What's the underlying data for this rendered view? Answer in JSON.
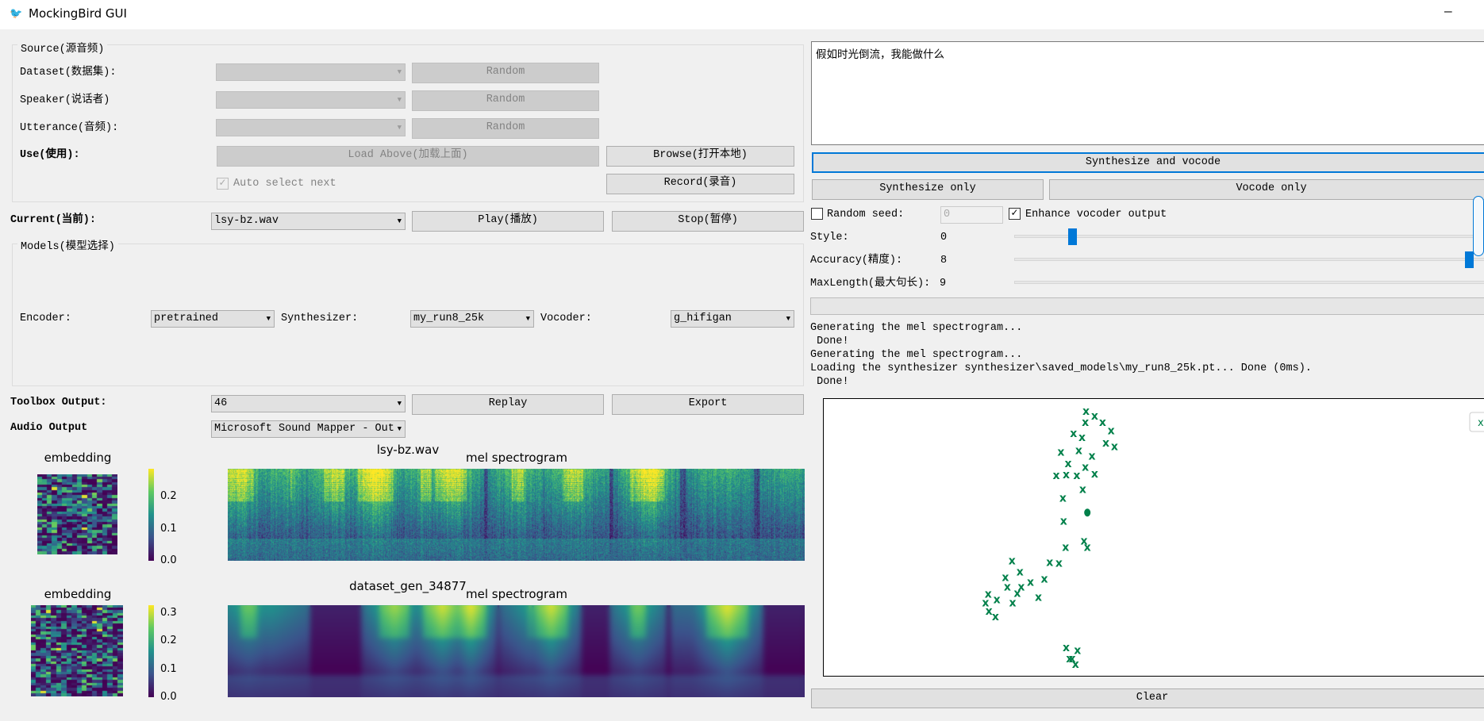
{
  "window": {
    "title": "MockingBird GUI",
    "minimize_icon": "minimize-icon"
  },
  "source": {
    "title": "Source(源音频)",
    "dataset_label": "Dataset(数据集):",
    "speaker_label": "Speaker(说话者)",
    "utterance_label": "Utterance(音频):",
    "random_label": "Random",
    "use_label": "Use(使用):",
    "load_above": "Load Above(加载上面)",
    "browse": "Browse(打开本地)",
    "record": "Record(录音)",
    "auto_select": "Auto select next",
    "auto_select_checked": true
  },
  "current": {
    "label": "Current(当前):",
    "value": "lsy-bz.wav",
    "play": "Play(播放)",
    "stop": "Stop(暂停)"
  },
  "models": {
    "title": "Models(模型选择)",
    "encoder_label": "Encoder:",
    "encoder": "pretrained",
    "synth_label": "Synthesizer:",
    "synth": "my_run8_25k",
    "vocoder_label": "Vocoder:",
    "vocoder": "g_hifigan"
  },
  "toolbox": {
    "label": "Toolbox Output:",
    "value": "46",
    "replay": "Replay",
    "export": "Export",
    "audio_label": "Audio Output",
    "audio_value": "Microsoft Sound Mapper - Out"
  },
  "plots": {
    "row1": {
      "embedding_title": "embedding",
      "file_title": "lsy-bz.wav",
      "mel_title": "mel spectrogram",
      "ticks": [
        "0.2",
        "0.1",
        "0.0"
      ]
    },
    "row2": {
      "embedding_title": "embedding",
      "file_title": "dataset_gen_34877",
      "mel_title": "mel spectrogram",
      "ticks": [
        "0.3",
        "0.2",
        "0.1",
        "0.0"
      ]
    }
  },
  "text_input": "假如时光倒流，我能做什么",
  "actions": {
    "synth_vocode": "Synthesize and vocode",
    "synth_only": "Synthesize only",
    "vocode_only": "Vocode only",
    "clear": "Clear"
  },
  "options": {
    "random_seed_label": "Random seed:",
    "random_seed_checked": false,
    "seed_value": "0",
    "enhance_label": "Enhance vocoder output",
    "enhance_checked": true,
    "style_label": "Style:",
    "style_value": "0",
    "accuracy_label": "Accuracy(精度):",
    "accuracy_value": "8",
    "maxlength_label": "MaxLength(最大句长):",
    "maxlength_value": "9"
  },
  "progress": 0,
  "log": [
    "Generating the mel spectrogram...",
    " Done!",
    "Generating the mel spectrogram...",
    "Loading the synthesizer synthesizer\\saved_models\\my_run8_25k.pt... Done (0ms).",
    " Done!"
  ],
  "accent_color": "#0078d7",
  "chart_data": {
    "type": "scatter",
    "xlim": [
      0,
      100
    ],
    "ylim": [
      0,
      100
    ],
    "grid": false,
    "color": "#00804a",
    "legend": "top-right",
    "points_x_marker": [
      [
        39.8,
        95.4
      ],
      [
        41.1,
        93.7
      ],
      [
        39.7,
        91.4
      ],
      [
        42.3,
        91.4
      ],
      [
        43.6,
        88.5
      ],
      [
        37.9,
        87.4
      ],
      [
        39.2,
        86.0
      ],
      [
        42.8,
        84.0
      ],
      [
        44.1,
        82.8
      ],
      [
        36.0,
        80.8
      ],
      [
        38.7,
        81.4
      ],
      [
        40.7,
        79.4
      ],
      [
        37.1,
        76.6
      ],
      [
        39.7,
        75.4
      ],
      [
        35.3,
        72.3
      ],
      [
        36.8,
        72.6
      ],
      [
        38.4,
        72.3
      ],
      [
        41.1,
        73.0
      ],
      [
        39.3,
        67.4
      ],
      [
        36.3,
        64.3
      ],
      [
        36.4,
        56.0
      ],
      [
        39.5,
        48.9
      ],
      [
        40.0,
        46.6
      ],
      [
        36.7,
        46.6
      ],
      [
        34.3,
        41.1
      ],
      [
        35.7,
        40.9
      ],
      [
        28.6,
        41.8
      ],
      [
        29.8,
        37.8
      ],
      [
        27.6,
        35.8
      ],
      [
        31.4,
        34.1
      ],
      [
        33.5,
        35.2
      ],
      [
        27.9,
        32.4
      ],
      [
        30.0,
        32.4
      ],
      [
        29.4,
        30.1
      ],
      [
        25.0,
        29.8
      ],
      [
        26.3,
        27.8
      ],
      [
        24.6,
        26.7
      ],
      [
        28.7,
        26.7
      ],
      [
        32.6,
        28.7
      ],
      [
        25.1,
        23.6
      ],
      [
        26.1,
        21.6
      ],
      [
        36.8,
        10.5
      ],
      [
        38.5,
        9.6
      ],
      [
        37.3,
        6.6
      ],
      [
        37.7,
        6.6
      ],
      [
        38.2,
        4.5
      ]
    ],
    "points_dot_marker": [
      [
        40.0,
        58.9
      ]
    ]
  }
}
